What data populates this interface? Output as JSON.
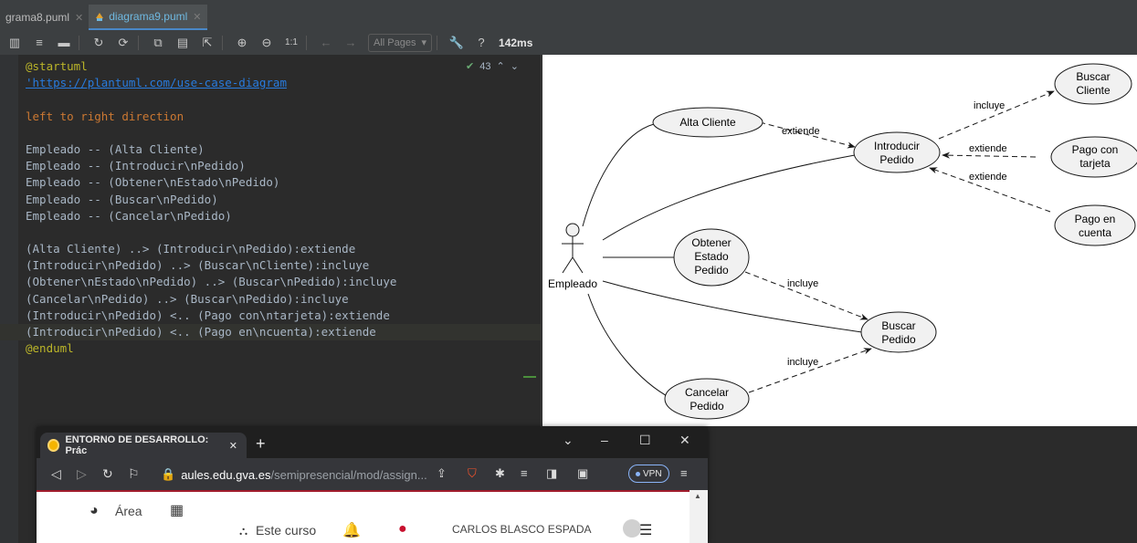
{
  "tabs": [
    {
      "label": "grama8.puml",
      "active": false
    },
    {
      "label": "diagrama9.puml",
      "active": true
    }
  ],
  "toolbar": {
    "zoom_label": "1:1",
    "pages_select": "All Pages",
    "help_label": "?",
    "timing": "142ms"
  },
  "editor": {
    "inspection_count": "43",
    "lines": [
      "@startuml",
      "'https://plantuml.com/use-case-diagram",
      "",
      "left to right direction",
      "",
      "Empleado -- (Alta Cliente)",
      "Empleado -- (Introducir\\nPedido)",
      "Empleado -- (Obtener\\nEstado\\nPedido)",
      "Empleado -- (Buscar\\nPedido)",
      "Empleado -- (Cancelar\\nPedido)",
      "",
      "(Alta Cliente) ..> (Introducir\\nPedido):extiende",
      "(Introducir\\nPedido) ..> (Buscar\\nCliente):incluye",
      "(Obtener\\nEstado\\nPedido) ..> (Buscar\\nPedido):incluye",
      "(Cancelar\\nPedido) ..> (Buscar\\nPedido):incluye",
      "(Introducir\\nPedido) <.. (Pago con\\ntarjeta):extiende",
      "(Introducir\\nPedido) <.. (Pago en\\ncuenta):extiende",
      "@enduml"
    ]
  },
  "diagram": {
    "actor": "Empleado",
    "use_cases": [
      {
        "id": "alta",
        "lines": [
          "Alta Cliente"
        ]
      },
      {
        "id": "introducir",
        "lines": [
          "Introducir",
          "Pedido"
        ]
      },
      {
        "id": "obtener",
        "lines": [
          "Obtener",
          "Estado",
          "Pedido"
        ]
      },
      {
        "id": "buscar-pedido",
        "lines": [
          "Buscar",
          "Pedido"
        ]
      },
      {
        "id": "cancelar",
        "lines": [
          "Cancelar",
          "Pedido"
        ]
      },
      {
        "id": "buscar-cliente",
        "lines": [
          "Buscar",
          "Cliente"
        ]
      },
      {
        "id": "pago-tarjeta",
        "lines": [
          "Pago con",
          "tarjeta"
        ]
      },
      {
        "id": "pago-cuenta",
        "lines": [
          "Pago en",
          "cuenta"
        ]
      }
    ],
    "relation_labels": {
      "alta_extiende": "extiende",
      "introducir_incluye": "incluye",
      "tarjeta_extiende": "extiende",
      "cuenta_extiende": "extiende",
      "obtener_incluye": "incluye",
      "cancelar_incluye": "incluye"
    }
  },
  "browser": {
    "tab_title": "ENTORNO DE DESARROLLO: Prác",
    "url_domain": "aules.edu.gva.es",
    "url_path": "/semipresencial/mod/assign...",
    "vpn_label": "VPN",
    "menu": {
      "area": "Área",
      "este_curso": "Este curso",
      "user_name": "CARLOS BLASCO ESPADA"
    }
  }
}
